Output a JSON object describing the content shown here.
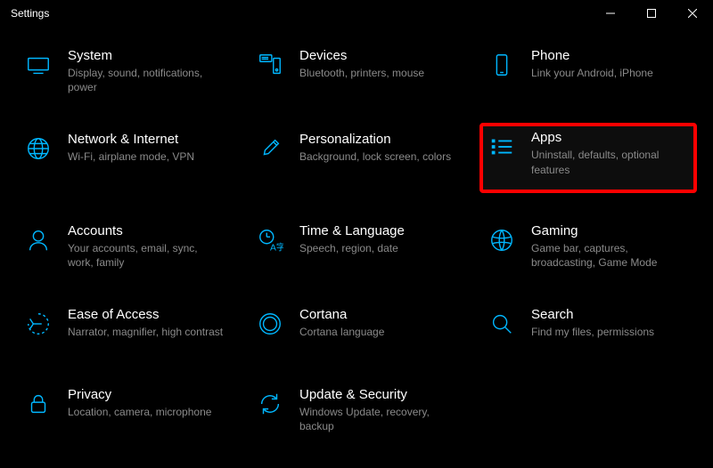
{
  "window": {
    "title": "Settings"
  },
  "accent": "#00b7ff",
  "tiles": [
    {
      "id": "system",
      "title": "System",
      "desc": "Display, sound, notifications, power",
      "highlighted": false
    },
    {
      "id": "devices",
      "title": "Devices",
      "desc": "Bluetooth, printers, mouse",
      "highlighted": false
    },
    {
      "id": "phone",
      "title": "Phone",
      "desc": "Link your Android, iPhone",
      "highlighted": false
    },
    {
      "id": "network",
      "title": "Network & Internet",
      "desc": "Wi-Fi, airplane mode, VPN",
      "highlighted": false
    },
    {
      "id": "personalization",
      "title": "Personalization",
      "desc": "Background, lock screen, colors",
      "highlighted": false
    },
    {
      "id": "apps",
      "title": "Apps",
      "desc": "Uninstall, defaults, optional features",
      "highlighted": true
    },
    {
      "id": "accounts",
      "title": "Accounts",
      "desc": "Your accounts, email, sync, work, family",
      "highlighted": false
    },
    {
      "id": "time",
      "title": "Time & Language",
      "desc": "Speech, region, date",
      "highlighted": false
    },
    {
      "id": "gaming",
      "title": "Gaming",
      "desc": "Game bar, captures, broadcasting, Game Mode",
      "highlighted": false
    },
    {
      "id": "ease",
      "title": "Ease of Access",
      "desc": "Narrator, magnifier, high contrast",
      "highlighted": false
    },
    {
      "id": "cortana",
      "title": "Cortana",
      "desc": "Cortana language",
      "highlighted": false
    },
    {
      "id": "search",
      "title": "Search",
      "desc": "Find my files, permissions",
      "highlighted": false
    },
    {
      "id": "privacy",
      "title": "Privacy",
      "desc": "Location, camera, microphone",
      "highlighted": false
    },
    {
      "id": "update",
      "title": "Update & Security",
      "desc": "Windows Update, recovery, backup",
      "highlighted": false
    }
  ]
}
